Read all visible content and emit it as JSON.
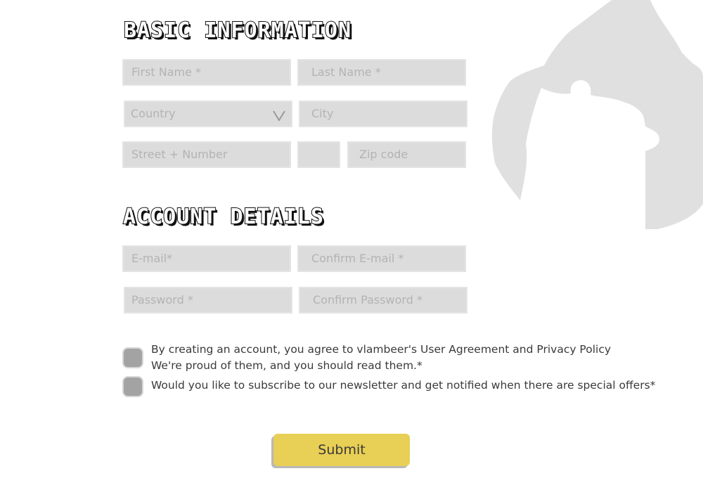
{
  "sections": {
    "basic": {
      "title": "BASIC INFORMATION"
    },
    "account": {
      "title": "ACCOUNT DETAILS"
    }
  },
  "fields": {
    "first_name": {
      "placeholder": "First Name *",
      "value": ""
    },
    "last_name": {
      "placeholder": "Last Name *",
      "value": ""
    },
    "country": {
      "placeholder": "Country",
      "selected": ""
    },
    "city": {
      "placeholder": "City",
      "value": ""
    },
    "street": {
      "placeholder": "Street + Number",
      "value": ""
    },
    "number_extra": {
      "placeholder": "",
      "value": ""
    },
    "zip": {
      "placeholder": "Zip code",
      "value": ""
    },
    "email": {
      "placeholder": "E-mail*",
      "value": ""
    },
    "confirm_email": {
      "placeholder": "Confirm E-mail *",
      "value": ""
    },
    "password": {
      "placeholder": "Password *",
      "value": ""
    },
    "confirm_password": {
      "placeholder": "Confirm Password *",
      "value": ""
    }
  },
  "agreement": {
    "line1": "By creating an account, you agree to vlambeer's User Agreement and Privacy Policy",
    "line2": "We're proud of them, and you should read them.*",
    "checked": false
  },
  "newsletter": {
    "text": "Would you like to subscribe to our newsletter and get notified when there are special offers*",
    "checked": false
  },
  "submit": {
    "label": "Submit"
  },
  "colors": {
    "field_bg": "#dcdcdc",
    "placeholder": "#b3b3b3",
    "checkbox": "#a3a3a3",
    "submit_bg": "#e8cf55",
    "decor": "#e0e0e0"
  },
  "icons": {
    "country_dropdown": "chevron-down-icon",
    "decoration": "puzzle-flame-shape"
  }
}
